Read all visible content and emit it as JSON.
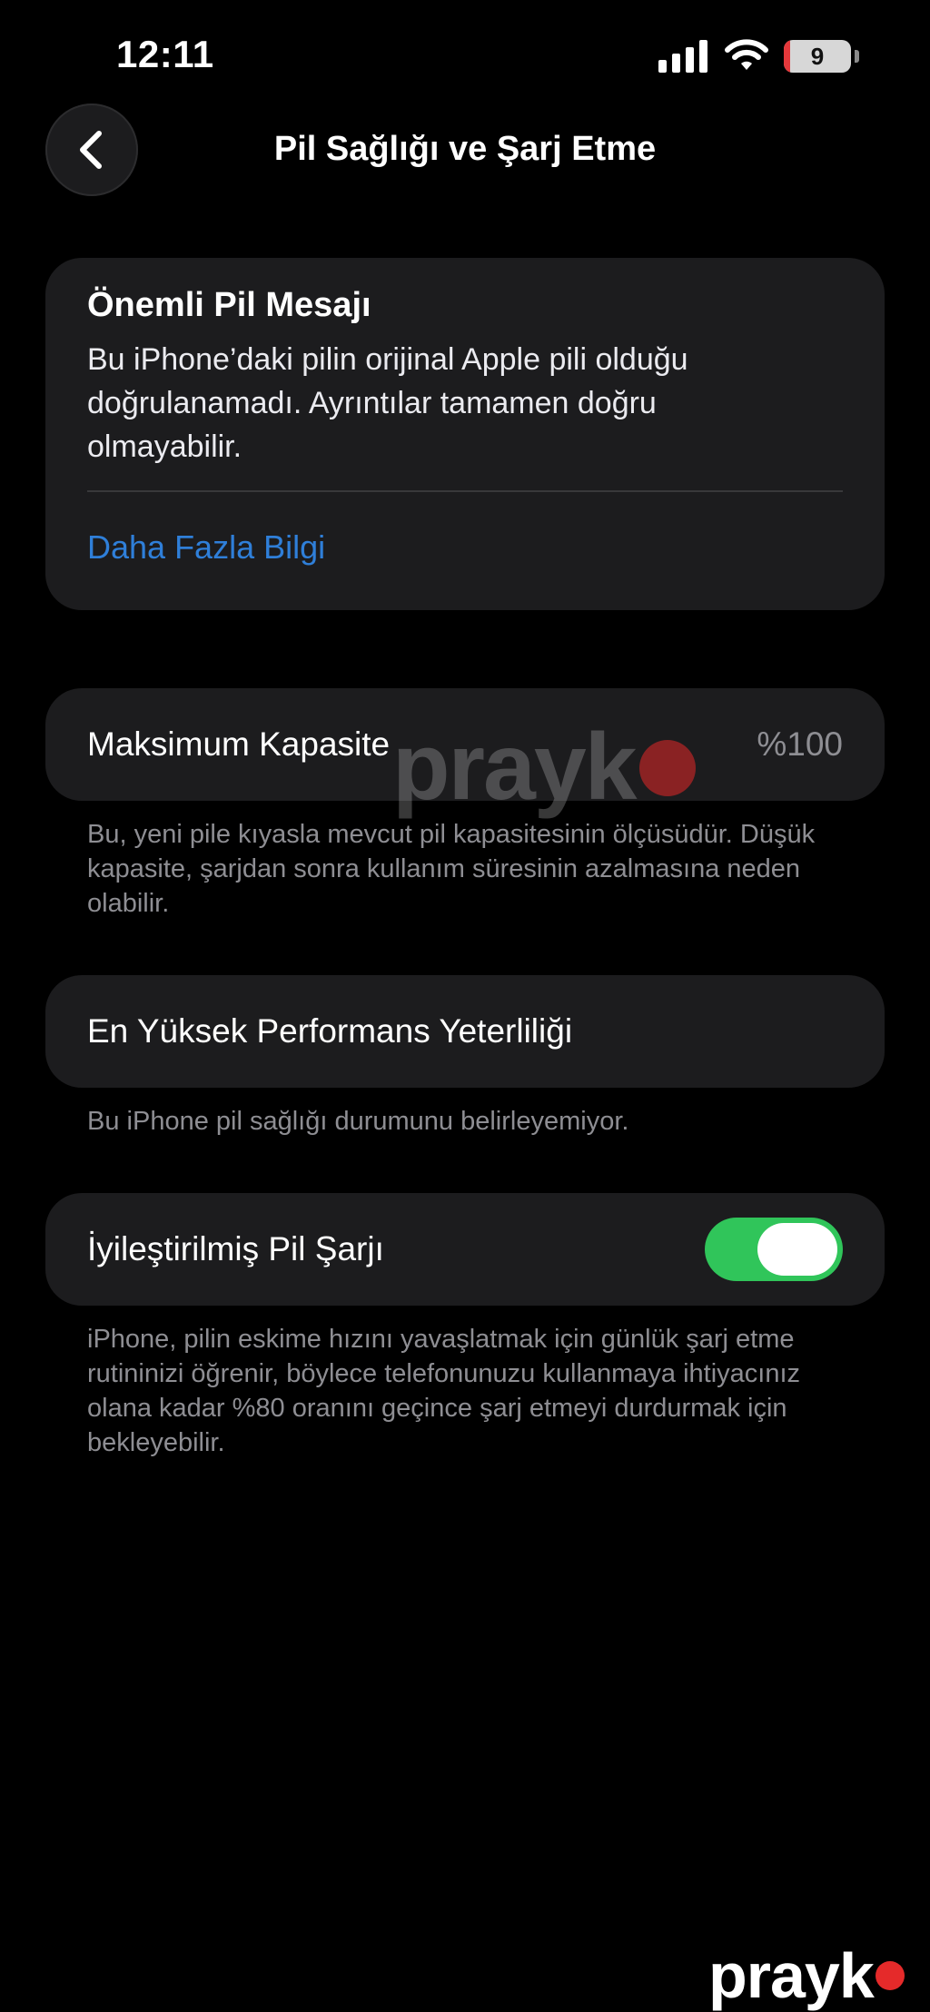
{
  "status_bar": {
    "time": "12:11",
    "battery_level": "9",
    "battery_fraction": 0.09,
    "battery_color": "#e5383b",
    "signal_icon": "cellular-signal-icon",
    "wifi_icon": "wifi-icon"
  },
  "nav": {
    "back_icon": "chevron-left-icon",
    "title": "Pil Sağlığı ve Şarj Etme"
  },
  "important_message": {
    "title": "Önemli Pil Mesajı",
    "body": "Bu iPhone’daki pilin orijinal Apple pili olduğu doğrulanamadı. Ayrıntılar tamamen doğru olmayabilir.",
    "link": "Daha Fazla Bilgi",
    "link_color": "#2f7fd9"
  },
  "max_capacity": {
    "label": "Maksimum Kapasite",
    "value": "%100",
    "footnote": "Bu, yeni pile kıyasla mevcut pil kapasitesinin ölçüsüdür. Düşük kapasite, şarjdan sonra kullanım süresinin azalmasına neden olabilir."
  },
  "peak_performance": {
    "label": "En Yüksek Performans Yeterliliği",
    "footnote": "Bu iPhone pil sağlığı durumunu belirleyemiyor."
  },
  "optimized_charging": {
    "label": "İyileştirilmiş Pil Şarjı",
    "enabled": true,
    "toggle_color": "#30c55a",
    "footnote": "iPhone, pilin eskime hızını yavaşlatmak için günlük şarj etme rutininizi öğrenir, böylece telefonunuzu kullanmaya ihtiyacınız olana kadar %80 oranını geçince şarj etmeyi durdurmak için bekleyebilir."
  },
  "watermark": {
    "text": "prayk"
  }
}
